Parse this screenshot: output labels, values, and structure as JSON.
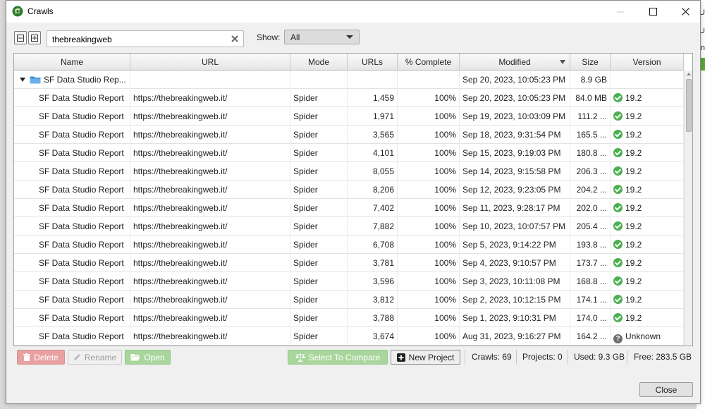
{
  "window": {
    "title": "Crawls"
  },
  "toolbar": {
    "collapse_icon": "collapse-all-icon",
    "expand_icon": "expand-all-icon",
    "search_value": "thebreakingweb",
    "show_label": "Show:",
    "show_value": "All"
  },
  "table": {
    "columns": [
      "Name",
      "URL",
      "Mode",
      "URLs",
      "% Complete",
      "Modified",
      "Size",
      "Version"
    ],
    "sort_column": "Modified",
    "group": {
      "name": "SF Data Studio Rep...",
      "modified": "Sep 20, 2023, 10:05:23 PM",
      "size": "8.9 GB"
    },
    "rows": [
      {
        "name": "SF Data Studio Report",
        "url": "https://thebreakingweb.it/",
        "mode": "Spider",
        "urls": "1,459",
        "complete": "100%",
        "modified": "Sep 20, 2023, 10:05:23 PM",
        "size": "84.0 MB",
        "version": "19.2",
        "status": "ok"
      },
      {
        "name": "SF Data Studio Report",
        "url": "https://thebreakingweb.it/",
        "mode": "Spider",
        "urls": "1,971",
        "complete": "100%",
        "modified": "Sep 19, 2023, 10:03:09 PM",
        "size": "111.2 ...",
        "version": "19.2",
        "status": "ok"
      },
      {
        "name": "SF Data Studio Report",
        "url": "https://thebreakingweb.it/",
        "mode": "Spider",
        "urls": "3,565",
        "complete": "100%",
        "modified": "Sep 18, 2023, 9:31:54 PM",
        "size": "165.5 ...",
        "version": "19.2",
        "status": "ok"
      },
      {
        "name": "SF Data Studio Report",
        "url": "https://thebreakingweb.it/",
        "mode": "Spider",
        "urls": "4,101",
        "complete": "100%",
        "modified": "Sep 15, 2023, 9:19:03 PM",
        "size": "180.8 ...",
        "version": "19.2",
        "status": "ok"
      },
      {
        "name": "SF Data Studio Report",
        "url": "https://thebreakingweb.it/",
        "mode": "Spider",
        "urls": "8,055",
        "complete": "100%",
        "modified": "Sep 14, 2023, 9:15:58 PM",
        "size": "206.3 ...",
        "version": "19.2",
        "status": "ok"
      },
      {
        "name": "SF Data Studio Report",
        "url": "https://thebreakingweb.it/",
        "mode": "Spider",
        "urls": "8,206",
        "complete": "100%",
        "modified": "Sep 12, 2023, 9:23:05 PM",
        "size": "204.2 ...",
        "version": "19.2",
        "status": "ok"
      },
      {
        "name": "SF Data Studio Report",
        "url": "https://thebreakingweb.it/",
        "mode": "Spider",
        "urls": "7,402",
        "complete": "100%",
        "modified": "Sep 11, 2023, 9:28:17 PM",
        "size": "202.0 ...",
        "version": "19.2",
        "status": "ok"
      },
      {
        "name": "SF Data Studio Report",
        "url": "https://thebreakingweb.it/",
        "mode": "Spider",
        "urls": "7,882",
        "complete": "100%",
        "modified": "Sep 10, 2023, 10:07:57 PM",
        "size": "205.4 ...",
        "version": "19.2",
        "status": "ok"
      },
      {
        "name": "SF Data Studio Report",
        "url": "https://thebreakingweb.it/",
        "mode": "Spider",
        "urls": "6,708",
        "complete": "100%",
        "modified": "Sep 5, 2023, 9:14:22 PM",
        "size": "193.8 ...",
        "version": "19.2",
        "status": "ok"
      },
      {
        "name": "SF Data Studio Report",
        "url": "https://thebreakingweb.it/",
        "mode": "Spider",
        "urls": "3,781",
        "complete": "100%",
        "modified": "Sep 4, 2023, 9:10:57 PM",
        "size": "173.7 ...",
        "version": "19.2",
        "status": "ok"
      },
      {
        "name": "SF Data Studio Report",
        "url": "https://thebreakingweb.it/",
        "mode": "Spider",
        "urls": "3,596",
        "complete": "100%",
        "modified": "Sep 3, 2023, 10:11:08 PM",
        "size": "168.8 ...",
        "version": "19.2",
        "status": "ok"
      },
      {
        "name": "SF Data Studio Report",
        "url": "https://thebreakingweb.it/",
        "mode": "Spider",
        "urls": "3,812",
        "complete": "100%",
        "modified": "Sep 2, 2023, 10:12:15 PM",
        "size": "174.1 ...",
        "version": "19.2",
        "status": "ok"
      },
      {
        "name": "SF Data Studio Report",
        "url": "https://thebreakingweb.it/",
        "mode": "Spider",
        "urls": "3,788",
        "complete": "100%",
        "modified": "Sep 1, 2023, 9:10:31 PM",
        "size": "174.0 ...",
        "version": "19.2",
        "status": "ok"
      },
      {
        "name": "SF Data Studio Report",
        "url": "https://thebreakingweb.it/",
        "mode": "Spider",
        "urls": "3,674",
        "complete": "100%",
        "modified": "Aug 31, 2023, 9:16:27 PM",
        "size": "164.2 ...",
        "version": "Unknown",
        "status": "unknown"
      }
    ]
  },
  "footer": {
    "delete_label": "Delete",
    "rename_label": "Rename",
    "open_label": "Open",
    "compare_label": "Select To Compare",
    "new_project_label": "New Project",
    "crawls": "Crawls: 69",
    "projects": "Projects: 0",
    "used": "Used: 9.3 GB",
    "free": "Free: 283.5 GB",
    "close_label": "Close"
  },
  "background": {
    "fragment_1": "U",
    "fragment_2": "U",
    "fragment_3": "n"
  },
  "colors": {
    "ok": "#4caf50",
    "delete": "#e8a0a0",
    "open": "#a9d69c",
    "folder": "#3b8fd6"
  }
}
